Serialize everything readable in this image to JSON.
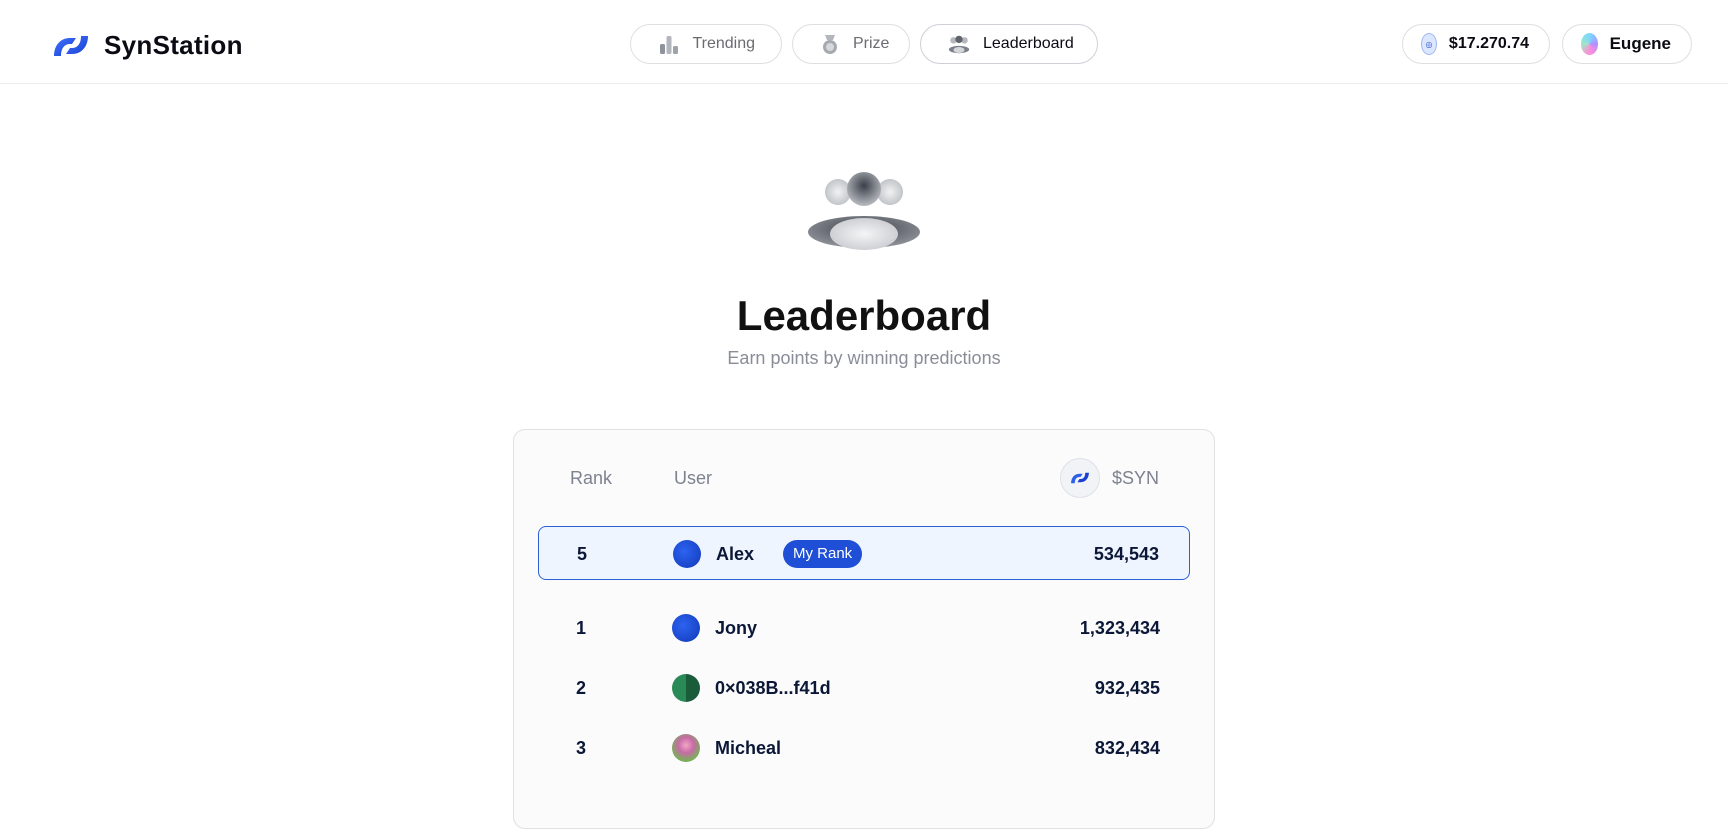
{
  "brand": {
    "name": "SynStation",
    "logo_icon": "synstation-logo-icon"
  },
  "nav": [
    {
      "label": "Trending",
      "icon": "bar-chart-icon",
      "active": false
    },
    {
      "label": "Prize",
      "icon": "medal-icon",
      "active": false
    },
    {
      "label": "Leaderboard",
      "icon": "users-icon",
      "active": true
    }
  ],
  "account": {
    "balance": "$17.270.74",
    "balance_icon": "coin-icon",
    "username": "Eugene",
    "avatar_icon": "gradient-avatar-icon"
  },
  "hero": {
    "icon": "users-group-icon",
    "title": "Leaderboard",
    "subtitle": "Earn points by winning predictions"
  },
  "table": {
    "headers": {
      "rank": "Rank",
      "user": "User",
      "points": "$SYN"
    },
    "points_icon": "syn-coin-icon",
    "my_rank": {
      "rank": "5",
      "user": "Alex",
      "badge": "My Rank",
      "value": "534,543",
      "avatar": "blue"
    },
    "rows": [
      {
        "rank": "1",
        "user": "Jony",
        "value": "1,323,434",
        "avatar": "blue"
      },
      {
        "rank": "2",
        "user": "0×038B...f41d",
        "value": "932,435",
        "avatar": "green"
      },
      {
        "rank": "3",
        "user": "Micheal",
        "value": "832,434",
        "avatar": "photo"
      }
    ]
  },
  "colors": {
    "accent": "#1f4fd6",
    "my_rank_bg": "#eef5ff",
    "muted_text": "#8a8d98"
  }
}
